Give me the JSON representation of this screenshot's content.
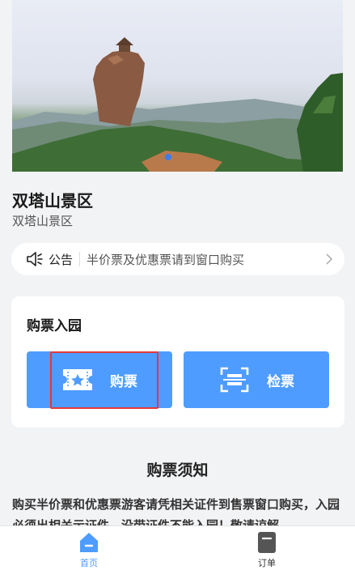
{
  "scenic": {
    "name": "双塔山景区",
    "subtitle": "双塔山景区"
  },
  "notice": {
    "label": "公告",
    "text": "半价票及优惠票请到窗口购买"
  },
  "ticket_card": {
    "title": "购票入园",
    "buy_label": "购票",
    "check_label": "检票"
  },
  "notes": {
    "title": "购票须知",
    "body": "购买半价票和优惠票游客请凭相关证件到售票窗口购买，入园必须出相关示证件，没带证件不能入园！敬请谅解"
  },
  "tabbar": {
    "home_label": "首页",
    "order_label": "订单"
  },
  "colors": {
    "accent": "#4e9cff",
    "highlight": "#e53935"
  }
}
